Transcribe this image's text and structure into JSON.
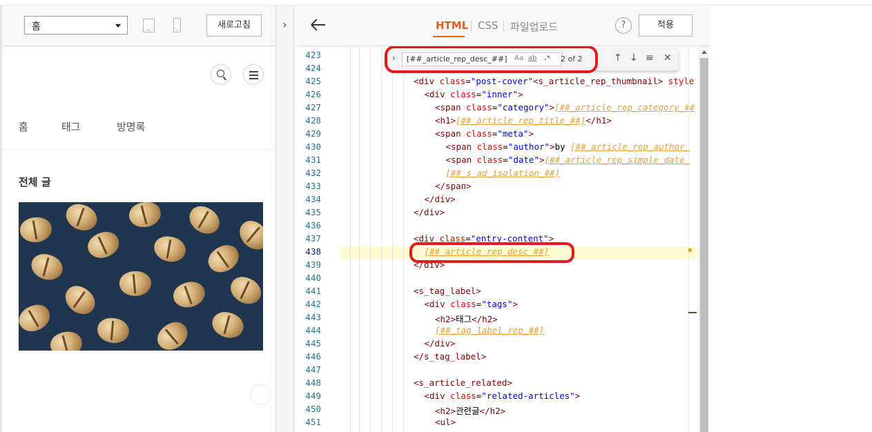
{
  "preview_toolbar": {
    "page_select_value": "홈",
    "refresh_label": "새로고침",
    "toggle_glyph": "›"
  },
  "blog": {
    "nav": [
      "홈",
      "태그",
      "방명록"
    ],
    "section_title": "전체 글"
  },
  "editor": {
    "tabs": [
      "HTML",
      "CSS",
      "파일업로드"
    ],
    "active_tab": "HTML",
    "help_label": "?",
    "apply_label": "적용",
    "active_line": 438,
    "accent_color": "#e55d23"
  },
  "find": {
    "query": "[##_article_rep_desc_##]",
    "opt_case": "Aa",
    "opt_word": "ab",
    "opt_regex": ".*",
    "count": "2 of 2",
    "prev_glyph": "↑",
    "next_glyph": "↓",
    "selection_glyph": "≡",
    "close_glyph": "✕"
  },
  "code": {
    "line_numbers": [
      423,
      424,
      425,
      426,
      427,
      428,
      429,
      430,
      431,
      432,
      433,
      434,
      435,
      436,
      437,
      438,
      439,
      440,
      441,
      442,
      443,
      444,
      445,
      446,
      447,
      448,
      449,
      450,
      451
    ],
    "lines": [
      {
        "indent": 0,
        "parts": []
      },
      {
        "indent": 0,
        "parts": []
      },
      {
        "indent": 0,
        "parts": [
          [
            "tg",
            "<div "
          ],
          [
            "at",
            "class"
          ],
          [
            "tx",
            "="
          ],
          [
            "av",
            "\"post-cover\""
          ],
          [
            "tg",
            "<s_article_rep_thumbnail> "
          ],
          [
            "at",
            "style"
          ]
        ]
      },
      {
        "indent": 1,
        "parts": [
          [
            "tg",
            "<div "
          ],
          [
            "at",
            "class"
          ],
          [
            "tx",
            "="
          ],
          [
            "av",
            "\"inner\""
          ],
          [
            "tg",
            ">"
          ]
        ]
      },
      {
        "indent": 2,
        "parts": [
          [
            "tg",
            "<span "
          ],
          [
            "at",
            "class"
          ],
          [
            "tx",
            "="
          ],
          [
            "av",
            "\"category\""
          ],
          [
            "tg",
            ">"
          ],
          [
            "tpl",
            "[##_article_rep_category_##"
          ]
        ]
      },
      {
        "indent": 2,
        "parts": [
          [
            "tg",
            "<h1>"
          ],
          [
            "tpl",
            "[##_article_rep_title_##]"
          ],
          [
            "tg",
            "</h1>"
          ]
        ]
      },
      {
        "indent": 2,
        "parts": [
          [
            "tg",
            "<span "
          ],
          [
            "at",
            "class"
          ],
          [
            "tx",
            "="
          ],
          [
            "av",
            "\"meta\""
          ],
          [
            "tg",
            ">"
          ]
        ]
      },
      {
        "indent": 3,
        "parts": [
          [
            "tg",
            "<span "
          ],
          [
            "at",
            "class"
          ],
          [
            "tx",
            "="
          ],
          [
            "av",
            "\"author\""
          ],
          [
            "tg",
            ">"
          ],
          [
            "tx",
            "by "
          ],
          [
            "tpl",
            "[##_article_rep_author_"
          ]
        ]
      },
      {
        "indent": 3,
        "parts": [
          [
            "tg",
            "<span "
          ],
          [
            "at",
            "class"
          ],
          [
            "tx",
            "="
          ],
          [
            "av",
            "\"date\""
          ],
          [
            "tg",
            ">"
          ],
          [
            "tpl",
            "[##_article_rep_simple_date_"
          ]
        ]
      },
      {
        "indent": 3,
        "parts": [
          [
            "tpl",
            "[##_s_ad_isolation_##]"
          ]
        ]
      },
      {
        "indent": 2,
        "parts": [
          [
            "tg",
            "</span>"
          ]
        ]
      },
      {
        "indent": 1,
        "parts": [
          [
            "tg",
            "</div>"
          ]
        ]
      },
      {
        "indent": 0,
        "parts": [
          [
            "tg",
            "</div>"
          ]
        ]
      },
      {
        "indent": 0,
        "parts": []
      },
      {
        "indent": 0,
        "parts": [
          [
            "tg",
            "<div "
          ],
          [
            "at",
            "class"
          ],
          [
            "tx",
            "="
          ],
          [
            "av",
            "\"entry-content\""
          ],
          [
            "tg",
            ">"
          ]
        ]
      },
      {
        "indent": 1,
        "parts": [
          [
            "tpl",
            "[##_article_rep_desc_##]"
          ]
        ]
      },
      {
        "indent": 0,
        "parts": [
          [
            "tg",
            "</div>"
          ]
        ]
      },
      {
        "indent": 0,
        "parts": []
      },
      {
        "indent": 0,
        "parts": [
          [
            "tg",
            "<s_tag_label>"
          ]
        ]
      },
      {
        "indent": 1,
        "parts": [
          [
            "tg",
            "<div "
          ],
          [
            "at",
            "class"
          ],
          [
            "tx",
            "="
          ],
          [
            "av",
            "\"tags\""
          ],
          [
            "tg",
            ">"
          ]
        ]
      },
      {
        "indent": 2,
        "parts": [
          [
            "tg",
            "<h2>"
          ],
          [
            "tx",
            "태그"
          ],
          [
            "tg",
            "</h2>"
          ]
        ]
      },
      {
        "indent": 2,
        "parts": [
          [
            "tpl",
            "[##_tag_label_rep_##]"
          ]
        ]
      },
      {
        "indent": 1,
        "parts": [
          [
            "tg",
            "</div>"
          ]
        ]
      },
      {
        "indent": 0,
        "parts": [
          [
            "tg",
            "</s_tag_label>"
          ]
        ]
      },
      {
        "indent": 0,
        "parts": []
      },
      {
        "indent": 0,
        "parts": [
          [
            "tg",
            "<s_article_related>"
          ]
        ]
      },
      {
        "indent": 1,
        "parts": [
          [
            "tg",
            "<div "
          ],
          [
            "at",
            "class"
          ],
          [
            "tx",
            "="
          ],
          [
            "av",
            "\"related-articles\""
          ],
          [
            "tg",
            ">"
          ]
        ]
      },
      {
        "indent": 2,
        "parts": [
          [
            "tg",
            "<h2>"
          ],
          [
            "tx",
            "관련글"
          ],
          [
            "tg",
            "</h2>"
          ]
        ]
      },
      {
        "indent": 2,
        "parts": [
          [
            "tg",
            "<ul>"
          ]
        ]
      }
    ]
  }
}
